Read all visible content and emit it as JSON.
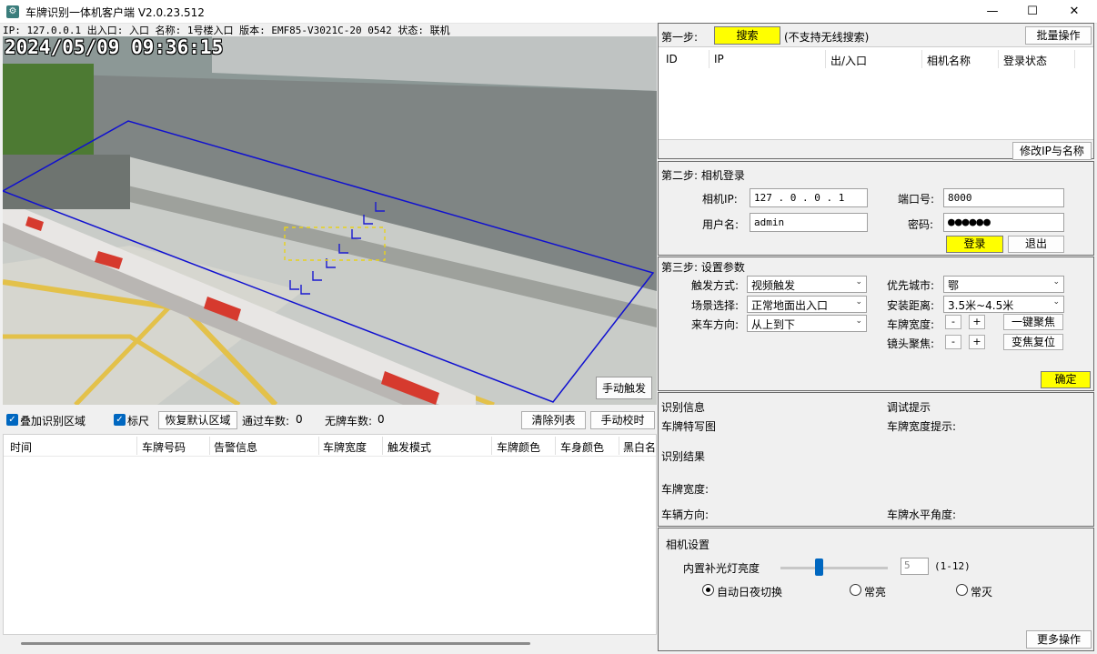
{
  "window": {
    "title": "车牌识别一体机客户端 V2.0.23.512",
    "minimize": "—",
    "maximize": "☐",
    "close": "✕"
  },
  "infobar": "IP: 127.0.0.1 出入口: 入口 名称: 1号楼入口 版本: EMF85-V3021C-20          0542 状态: 联机",
  "video": {
    "timestamp": "2024/05/09 09:36:15",
    "manual_trigger": "手动触发"
  },
  "toolbar": {
    "overlay_zone_label": "叠加识别区域",
    "overlay_zone_checked": true,
    "ruler_label": "标尺",
    "ruler_checked": true,
    "restore_default_zone": "恢复默认区域",
    "passed_count_label": "通过车数:",
    "passed_count": "0",
    "no_plate_count_label": "无牌车数:",
    "no_plate_count": "0",
    "clear_list": "清除列表",
    "manual_calibrate": "手动校时"
  },
  "records_table": {
    "columns": [
      "时间",
      "车牌号码",
      "告警信息",
      "车牌宽度",
      "触发模式",
      "车牌颜色",
      "车身颜色",
      "黑白名"
    ]
  },
  "step1": {
    "label": "第一步:",
    "search_button": "搜索",
    "note": "(不支持无线搜索)",
    "batch_button": "批量操作",
    "columns": [
      "ID",
      "IP",
      "出/入口",
      "相机名称",
      "登录状态"
    ],
    "modify_button": "修改IP与名称"
  },
  "step2": {
    "title": "第二步: 相机登录",
    "camera_ip_label": "相机IP:",
    "camera_ip": "127 . 0 . 0 . 1",
    "port_label": "端口号:",
    "port": "8000",
    "username_label": "用户名:",
    "username": "admin",
    "password_label": "密码:",
    "password": "●●●●●●",
    "login_button": "登录",
    "logout_button": "退出"
  },
  "step3": {
    "title": "第三步: 设置参数",
    "trigger_mode_label": "触发方式:",
    "trigger_mode": "视频触发",
    "priority_city_label": "优先城市:",
    "priority_city": "鄂",
    "scene_label": "场景选择:",
    "scene": "正常地面出入口",
    "install_distance_label": "安装距离:",
    "install_distance": "3.5米~4.5米",
    "direction_label": "来车方向:",
    "direction": "从上到下",
    "plate_width_label": "车牌宽度:",
    "lens_focus_label": "镜头聚焦:",
    "minus": "-",
    "plus": "+",
    "one_key_focus": "一键聚焦",
    "zoom_reset": "变焦复位",
    "confirm_button": "确定"
  },
  "recognition": {
    "info_label": "识别信息",
    "debug_label": "调试提示",
    "plate_closeup_label": "车牌特写图",
    "plate_width_hint_label": "车牌宽度提示:",
    "result_label": "识别结果",
    "plate_width_label": "车牌宽度:",
    "vehicle_direction_label": "车辆方向:",
    "plate_angle_label": "车牌水平角度:"
  },
  "camera_settings": {
    "title": "相机设置",
    "fill_light_label": "内置补光灯亮度",
    "fill_light_value": "5",
    "fill_light_level": 0.36,
    "fill_light_range": "(1-12)",
    "auto_day_night": "自动日夜切换",
    "always_on": "常亮",
    "always_off": "常灭",
    "more_button": "更多操作"
  },
  "colors": {
    "accent": "#0067c0",
    "highlight": "#ffff00",
    "zone_line": "#1010d0"
  }
}
